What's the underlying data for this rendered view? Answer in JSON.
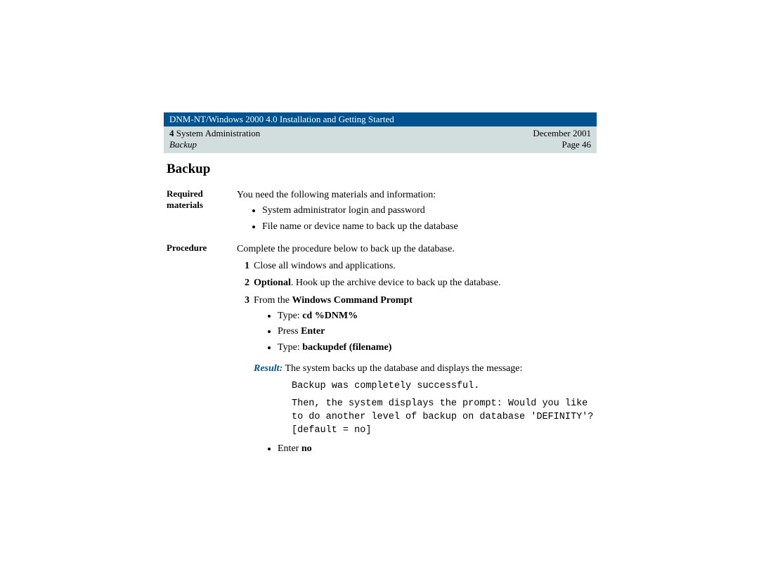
{
  "header": {
    "title": "DNM-NT/Windows 2000 4.0 Installation and Getting Started",
    "sectno": "4",
    "section": "System Administration",
    "subsection": "Backup",
    "date": "December 2001",
    "page": "Page 46"
  },
  "heading": "Backup",
  "required": {
    "label": "Required materials",
    "intro": "You need the following materials and information:",
    "items": [
      "System administrator login and password",
      "File name or device name to back up the database"
    ]
  },
  "procedure": {
    "label": "Procedure",
    "intro": "Complete the procedure below to back up the database.",
    "step1": "Close all windows and applications.",
    "step2_bold": "Optional",
    "step2_rest": ". Hook up the archive device to back up the database.",
    "step3_pre": "From the ",
    "step3_bold": "Windows Command Prompt",
    "step3_b1_pre": "Type: ",
    "step3_b1_bold": "cd %DNM%",
    "step3_b2_pre": "Press ",
    "step3_b2_bold": "Enter",
    "step3_b3_pre": "Type: ",
    "step3_b3_bold": "backupdef (filename)",
    "result_label": "Result:",
    "result_text": " The system backs up the database and displays the message:",
    "mono1": "Backup was completely successful.",
    "mono2": "Then, the system displays the prompt: Would you like to do another level of backup on database 'DEFINITY'? [default = no]",
    "final_b_pre": "Enter ",
    "final_b_bold": "no"
  }
}
